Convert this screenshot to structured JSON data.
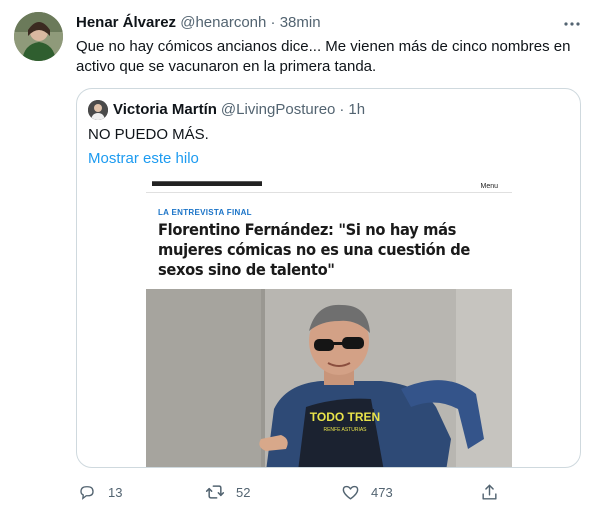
{
  "tweet": {
    "author_name": "Henar Álvarez",
    "author_handle": "@henarconh",
    "separator": "·",
    "time": "38min",
    "text": "Que no hay cómicos ancianos dice... Me vienen más de cinco nombres en activo que se vacunaron en la primera tanda."
  },
  "quote": {
    "author_name": "Victoria Martín",
    "author_handle": "@LivingPostureo",
    "separator": "·",
    "time": "1h",
    "text": "NO PUEDO MÁS.",
    "thread_link": "Mostrar este hilo",
    "media": {
      "menu_label": "Menu",
      "kicker": "LA ENTREVISTA FINAL",
      "headline": "Florentino Fernández: \"Si no hay más mujeres cómicas no es una cuestión de sexos sino de talento\"",
      "shirt_text": "TODO TREN",
      "shirt_subtext": "RENFE ASTURIAS"
    }
  },
  "actions": {
    "reply_count": "13",
    "retweet_count": "52",
    "like_count": "473"
  },
  "icons": {
    "more": "more-icon",
    "reply": "reply-icon",
    "retweet": "retweet-icon",
    "like": "heart-icon",
    "share": "share-icon"
  },
  "colors": {
    "link": "#1d9bf0",
    "secondary_text": "#536471",
    "border": "#cfd9de",
    "kicker": "#1a73c7"
  }
}
